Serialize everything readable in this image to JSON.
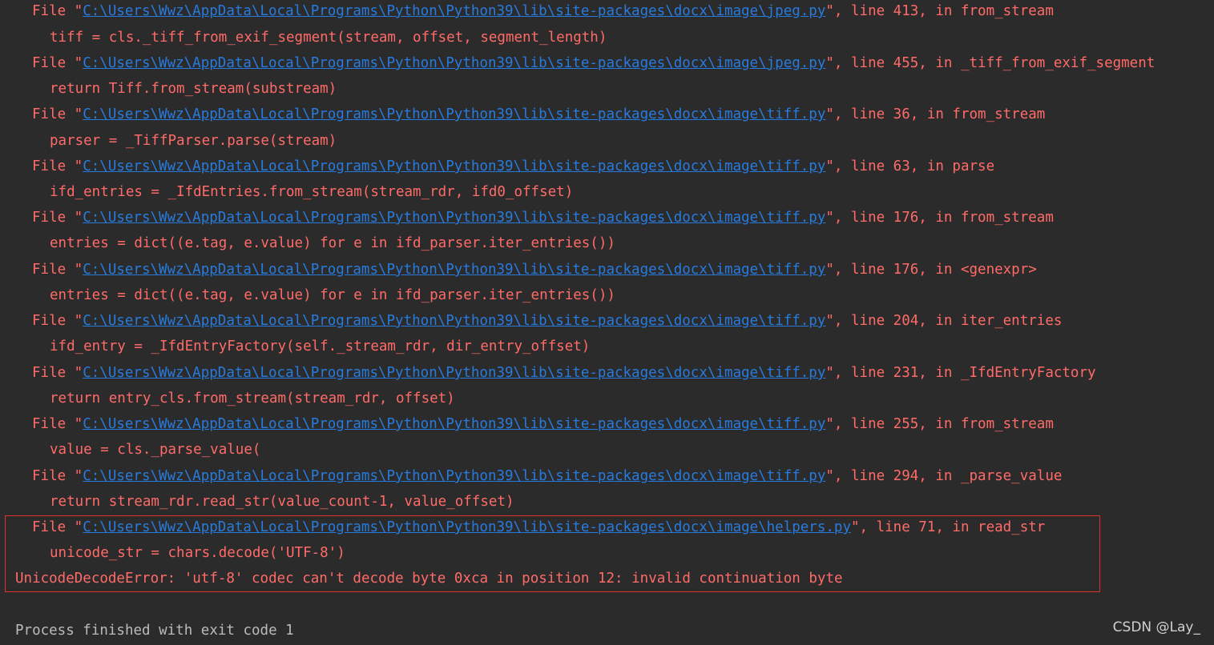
{
  "colors": {
    "background": "#2b2b2b",
    "error_text": "#ff6b68",
    "link": "#287bde",
    "plain_text": "#bbbbbb",
    "highlight_border": "#e0302f"
  },
  "traceback": {
    "frames": [
      {
        "prefix": "File \"",
        "path": "C:\\Users\\Wwz\\AppData\\Local\\Programs\\Python\\Python39\\lib\\site-packages\\docx\\image\\jpeg.py",
        "suffix": "\", line 413, in from_stream",
        "code": "tiff = cls._tiff_from_exif_segment(stream, offset, segment_length)"
      },
      {
        "prefix": "File \"",
        "path": "C:\\Users\\Wwz\\AppData\\Local\\Programs\\Python\\Python39\\lib\\site-packages\\docx\\image\\jpeg.py",
        "suffix": "\", line 455, in _tiff_from_exif_segment",
        "code": "return Tiff.from_stream(substream)"
      },
      {
        "prefix": "File \"",
        "path": "C:\\Users\\Wwz\\AppData\\Local\\Programs\\Python\\Python39\\lib\\site-packages\\docx\\image\\tiff.py",
        "suffix": "\", line 36, in from_stream",
        "code": "parser = _TiffParser.parse(stream)"
      },
      {
        "prefix": "File \"",
        "path": "C:\\Users\\Wwz\\AppData\\Local\\Programs\\Python\\Python39\\lib\\site-packages\\docx\\image\\tiff.py",
        "suffix": "\", line 63, in parse",
        "code": "ifd_entries = _IfdEntries.from_stream(stream_rdr, ifd0_offset)"
      },
      {
        "prefix": "File \"",
        "path": "C:\\Users\\Wwz\\AppData\\Local\\Programs\\Python\\Python39\\lib\\site-packages\\docx\\image\\tiff.py",
        "suffix": "\", line 176, in from_stream",
        "code": "entries = dict((e.tag, e.value) for e in ifd_parser.iter_entries())"
      },
      {
        "prefix": "File \"",
        "path": "C:\\Users\\Wwz\\AppData\\Local\\Programs\\Python\\Python39\\lib\\site-packages\\docx\\image\\tiff.py",
        "suffix": "\", line 176, in <genexpr>",
        "code": "entries = dict((e.tag, e.value) for e in ifd_parser.iter_entries())"
      },
      {
        "prefix": "File \"",
        "path": "C:\\Users\\Wwz\\AppData\\Local\\Programs\\Python\\Python39\\lib\\site-packages\\docx\\image\\tiff.py",
        "suffix": "\", line 204, in iter_entries",
        "code": "ifd_entry = _IfdEntryFactory(self._stream_rdr, dir_entry_offset)"
      },
      {
        "prefix": "File \"",
        "path": "C:\\Users\\Wwz\\AppData\\Local\\Programs\\Python\\Python39\\lib\\site-packages\\docx\\image\\tiff.py",
        "suffix": "\", line 231, in _IfdEntryFactory",
        "code": "return entry_cls.from_stream(stream_rdr, offset)"
      },
      {
        "prefix": "File \"",
        "path": "C:\\Users\\Wwz\\AppData\\Local\\Programs\\Python\\Python39\\lib\\site-packages\\docx\\image\\tiff.py",
        "suffix": "\", line 255, in from_stream",
        "code": "value = cls._parse_value("
      },
      {
        "prefix": "File \"",
        "path": "C:\\Users\\Wwz\\AppData\\Local\\Programs\\Python\\Python39\\lib\\site-packages\\docx\\image\\tiff.py",
        "suffix": "\", line 294, in _parse_value",
        "code": "return stream_rdr.read_str(value_count-1, value_offset)"
      },
      {
        "prefix": "File \"",
        "path": "C:\\Users\\Wwz\\AppData\\Local\\Programs\\Python\\Python39\\lib\\site-packages\\docx\\image\\helpers.py",
        "suffix": "\", line 71, in read_str",
        "code": "unicode_str = chars.decode('UTF-8')"
      }
    ],
    "error": "UnicodeDecodeError: 'utf-8' codec can't decode byte 0xca in position 12: invalid continuation byte"
  },
  "process_message": "Process finished with exit code 1",
  "watermark": "CSDN @Lay_"
}
